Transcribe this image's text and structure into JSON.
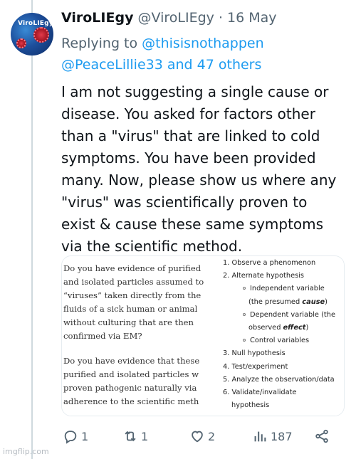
{
  "tweet": {
    "display_name": "ViroLIEgy",
    "handle": "@ViroLIEgy",
    "separator": "·",
    "date": "16 May",
    "avatar_text": "ViroLIEgy",
    "replying_prefix": "Replying to ",
    "replying_mention_1": "@thisisnothappen",
    "replying_mention_2": "@PeaceLillie33",
    "replying_and": " and ",
    "replying_others": "47 others",
    "text_lines": [
      "I am not suggesting a single cause or",
      "disease. You asked for factors other",
      "than a \"virus\" that are linked to cold",
      "symptoms. You have been provided",
      "many. Now, please show us where any",
      "\"virus\" was scientifically proven to",
      "exist & cause these same symptoms",
      "via the scientific method."
    ]
  },
  "media": {
    "question_1_lines": [
      "Do you have evidence of purified",
      "and isolated particles assumed to",
      "“viruses” taken directly from the",
      "fluids of a sick human or animal",
      "without culturing that are then",
      "confirmed via EM?"
    ],
    "question_2_lines": [
      "Do you have evidence that these",
      "purified and isolated particles w",
      "proven pathogenic naturally via",
      "adherence to the scientific meth"
    ],
    "steps": {
      "s1": "1. Observe a phenomenon",
      "s2": "2. Alternate hypothesis",
      "s2a": "Independent variable",
      "s2a_cont_prefix": "(the presumed ",
      "s2a_cont_em": "cause",
      "s2a_cont_suffix": ")",
      "s2b": "Dependent variable (the",
      "s2b_cont_prefix": "observed ",
      "s2b_cont_em": "effect",
      "s2b_cont_suffix": ")",
      "s2c": "Control variables",
      "s3": "3. Null hypothesis",
      "s4": "4. Test/experiment",
      "s5": "5. Analyze the observation/data",
      "s6": "6. Validate/invalidate",
      "s6_cont": "hypothesis"
    }
  },
  "actions": {
    "reply_count": "1",
    "retweet_count": "1",
    "like_count": "2",
    "views_count": "187"
  },
  "watermark": "imgflip.com"
}
